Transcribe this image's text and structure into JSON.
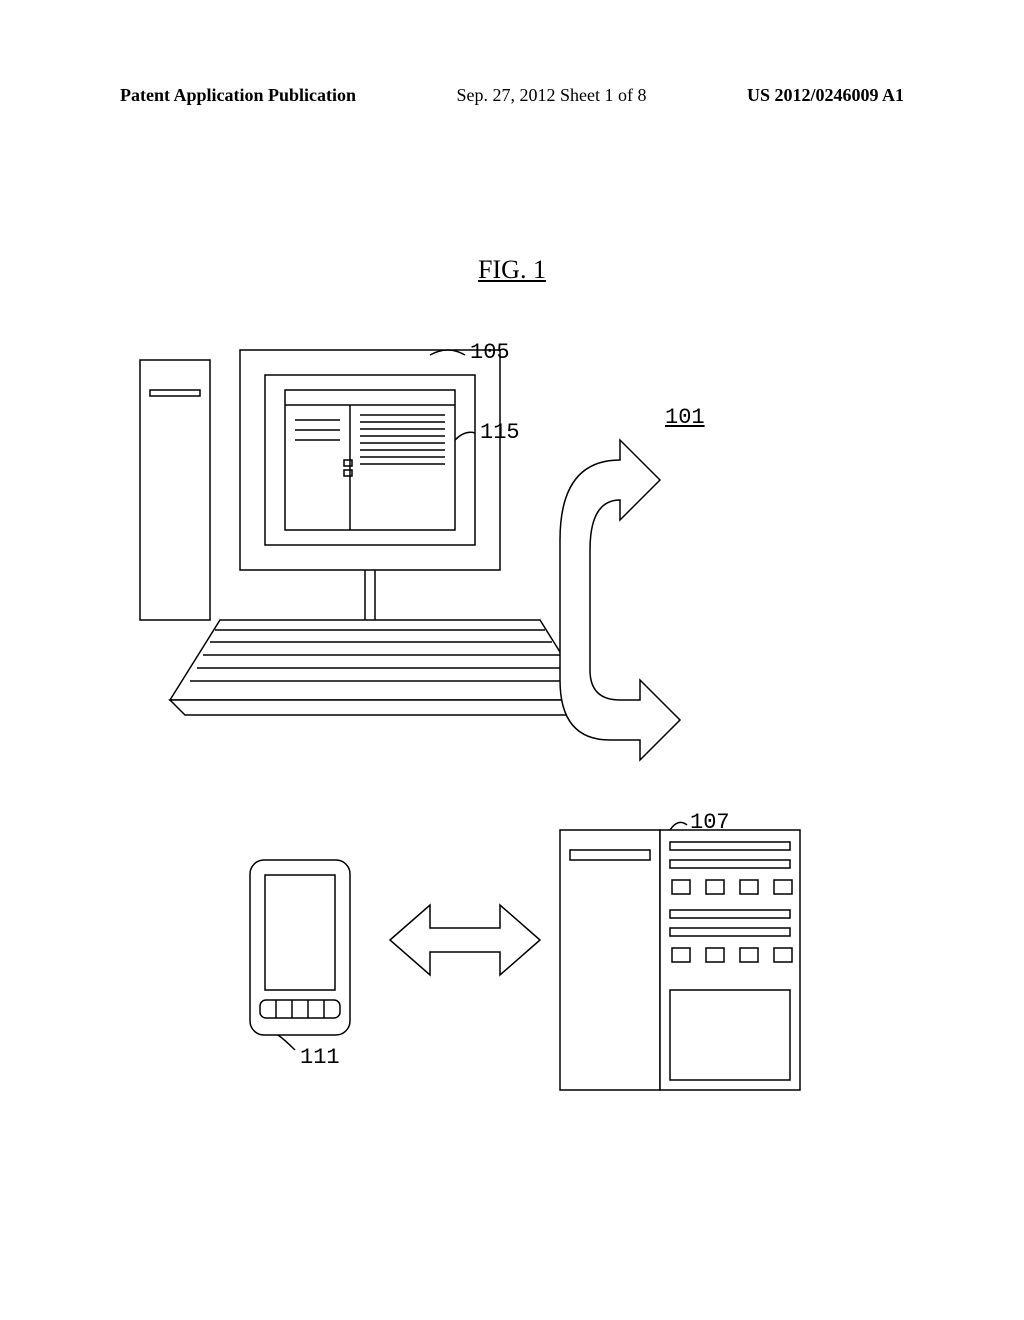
{
  "header": {
    "left": "Patent Application Publication",
    "center": "Sep. 27, 2012  Sheet 1 of 8",
    "right": "US 2012/0246009 A1"
  },
  "figure_label": "FIG. 1",
  "refs": {
    "r105": "105",
    "r115": "115",
    "r101": "101",
    "r111": "111",
    "r107": "107"
  }
}
